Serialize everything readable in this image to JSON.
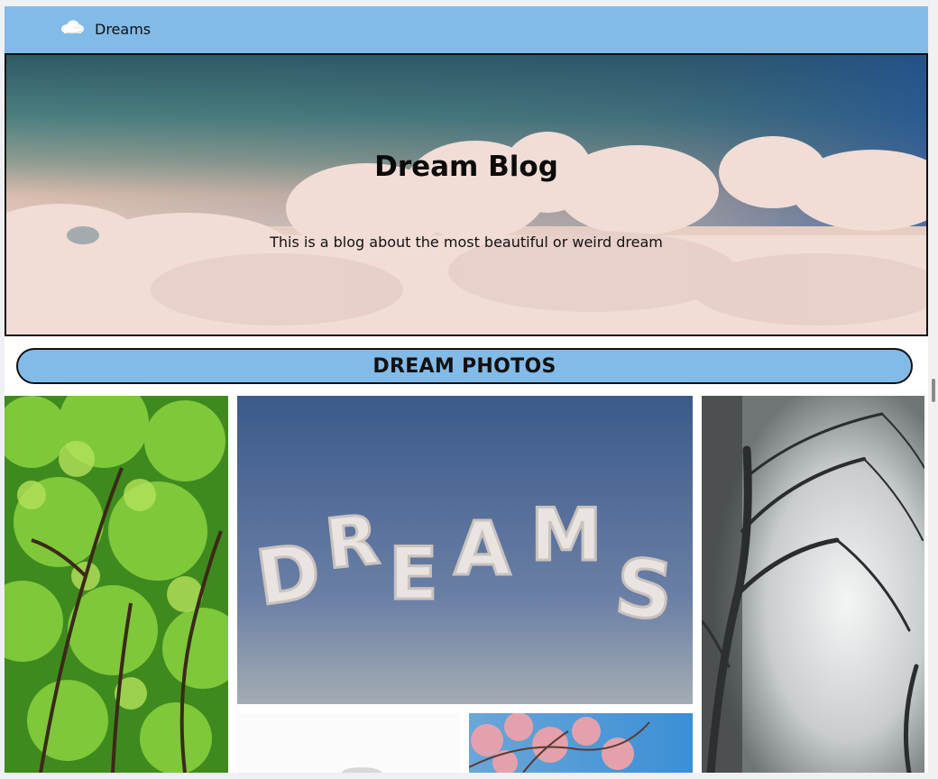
{
  "navbar": {
    "brand_label": "Dreams",
    "brand_icon": "cloud-icon",
    "background_color": "#82bbe8"
  },
  "hero": {
    "title": "Dream Blog",
    "subtitle": "This is a blog about the most beautiful or weird dream"
  },
  "photos_section": {
    "heading": "DREAM PHOTOS",
    "photos": [
      {
        "name": "green-forest-photo"
      },
      {
        "name": "dreams-clouds-photo"
      },
      {
        "name": "misty-trees-photo"
      },
      {
        "name": "white-photo"
      },
      {
        "name": "cherry-blossom-photo"
      }
    ]
  }
}
